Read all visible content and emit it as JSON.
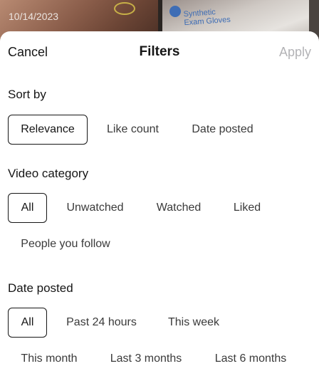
{
  "background": {
    "thumb_1_date": "10/14/2023",
    "thumb_2_label_line1": "Synthetic",
    "thumb_2_label_line2": "Exam Gloves"
  },
  "header": {
    "cancel_label": "Cancel",
    "title": "Filters",
    "apply_label": "Apply"
  },
  "sections": {
    "sort_by": {
      "title": "Sort by",
      "options": [
        "Relevance",
        "Like count",
        "Date posted"
      ],
      "selected": "Relevance"
    },
    "video_category": {
      "title": "Video category",
      "options": [
        "All",
        "Unwatched",
        "Watched",
        "Liked",
        "People you follow"
      ],
      "selected": "All"
    },
    "date_posted": {
      "title": "Date posted",
      "options": [
        "All",
        "Past 24 hours",
        "This week",
        "This month",
        "Last 3 months",
        "Last 6 months"
      ],
      "selected": "All"
    }
  },
  "colors": {
    "text": "#161616",
    "disabled": "#b3b3b6",
    "sheet": "#ffffff"
  }
}
